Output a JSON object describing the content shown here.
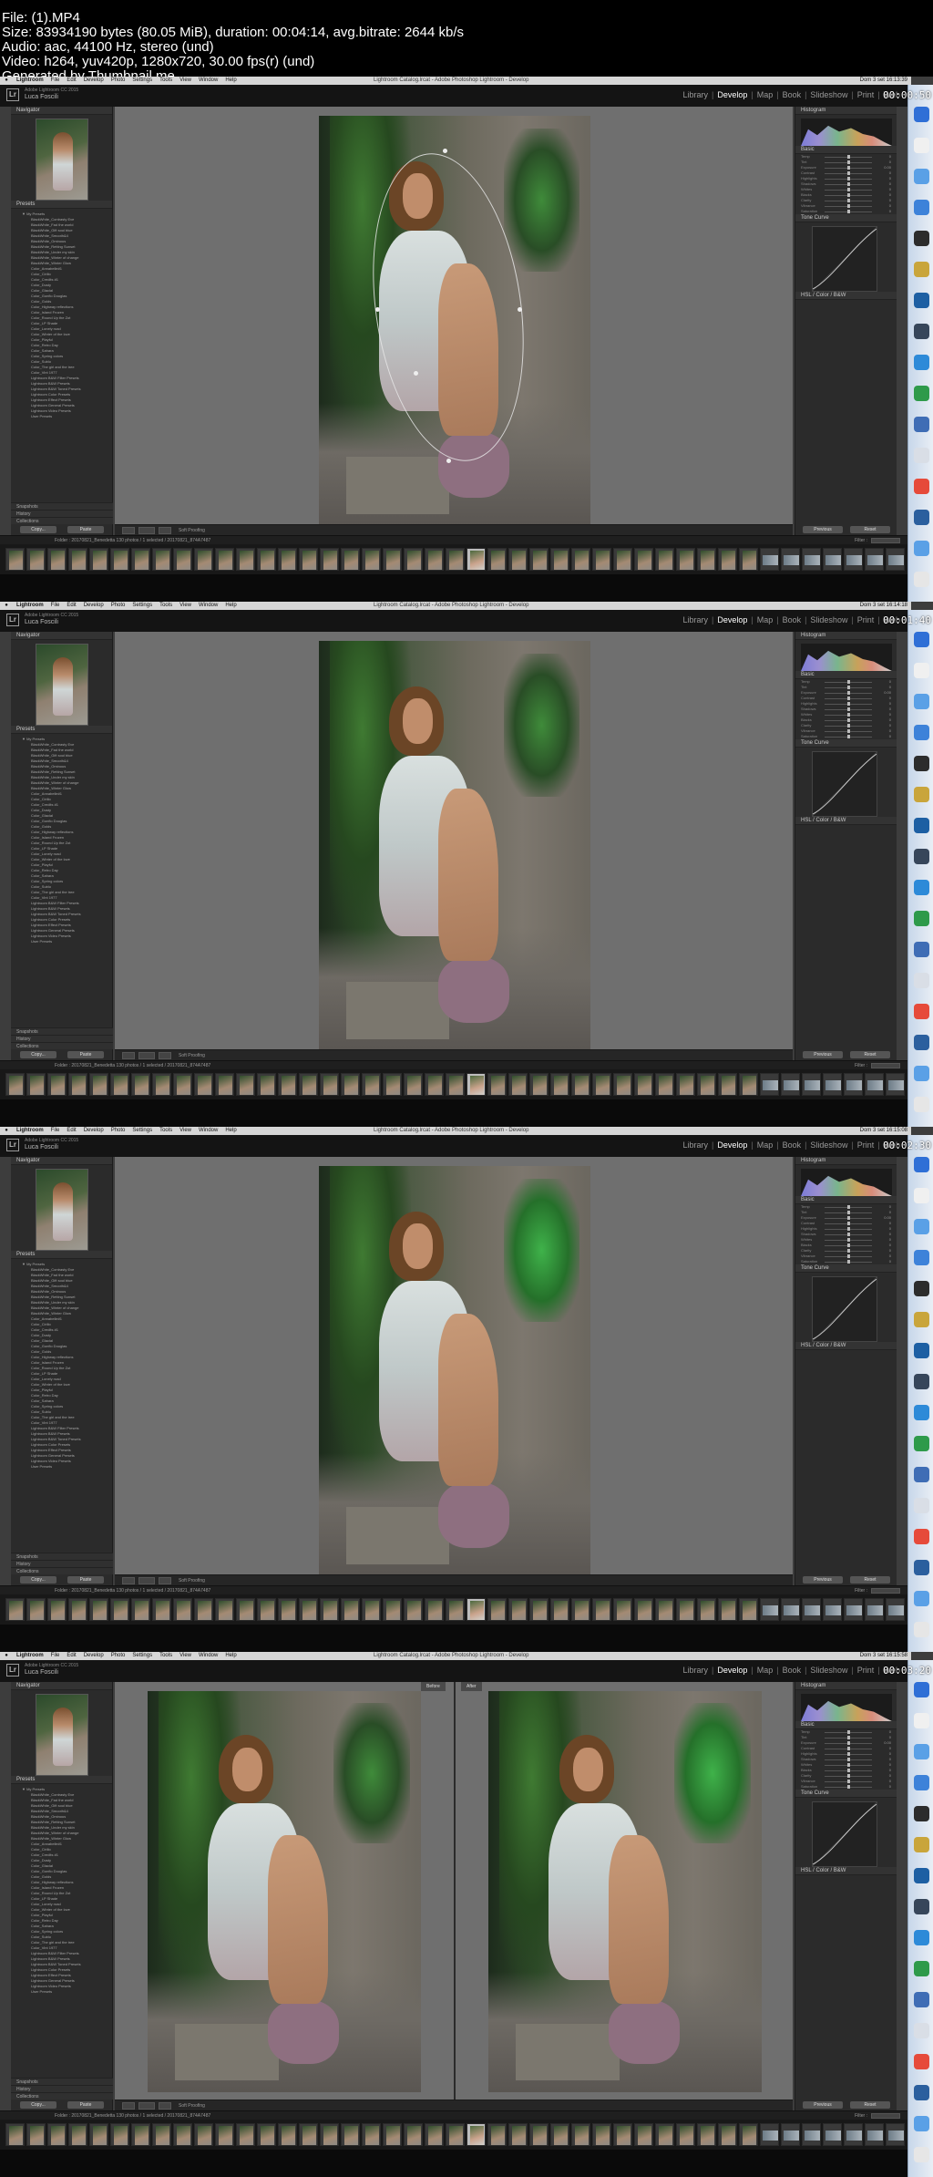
{
  "file_info": [
    "File:  (1).MP4",
    "Size: 83934190 bytes (80.05 MiB), duration: 00:04:14, avg.bitrate: 2644 kb/s",
    "Audio: aac, 44100 Hz, stereo (und)",
    "Video: h264, yuv420p, 1280x720, 30.00 fps(r) (und)",
    "Generated by Thumbnail me"
  ],
  "mac_menu": {
    "app": "Lightroom",
    "items": [
      "File",
      "Edit",
      "Develop",
      "Photo",
      "Settings",
      "Tools",
      "View",
      "Window",
      "Help"
    ]
  },
  "window_title": "Lightroom Catalog.lrcat - Adobe Photoshop Lightroom - Develop",
  "lr": {
    "logo": "Lr",
    "version": "Adobe Lightroom CC 2015",
    "user": "Luca Foscili"
  },
  "modules": [
    "Library",
    "Develop",
    "Map",
    "Book",
    "Slideshow",
    "Print",
    "Web"
  ],
  "active_module": "Develop",
  "left_panel": {
    "navigator": "Navigator",
    "presets": "Presets",
    "presets_items": [
      "▼ My Presets",
      "BlackWhite_Contrasty Eve",
      "BlackWhite_Fad the world",
      "BlackWhite_Gift soul blue",
      "BlackWhite_Smooth&4",
      "BlackWhite_Ominous",
      "BlackWhite_Retting Sunset",
      "BlackWhite_Under my skin",
      "BlackWhite_Winter of change",
      "BlackWhite_Winter Glow",
      "Color_Annabelle#1",
      "Color_Cirillo",
      "Color_Credits #1",
      "Color_Dusty",
      "Color_Glacial",
      "Color_Gonfio Douglas",
      "Color_Golds",
      "Color_Highway reflections",
      "Color_Island Frozen",
      "Color_Round Up the Zot",
      "Color_LP Shade",
      "Color_Lonely road",
      "Color_Winter of the love",
      "Color_Playful",
      "Color_Retro Day",
      "Color_Sahara",
      "Color_Spring colors",
      "Color_Sublo",
      "Color_The girl and the tree",
      "Color_Vint 1977",
      "Lightroom B&W Filter Presets",
      "Lightroom B&W Presets",
      "Lightroom B&W Toned Presets",
      "Lightroom Color Presets",
      "Lightroom Effect Presets",
      "Lightroom General Presets",
      "Lightroom Video Presets",
      "User Presets"
    ],
    "snapshots": "Snapshots",
    "history": "History",
    "collections": "Collections",
    "copy_button": "Copy...",
    "paste_button": "Paste"
  },
  "right_panel": {
    "histogram": "Histogram",
    "basic": "Basic",
    "tone_curve": "Tone Curve",
    "hsl": "HSL / Color / B&W",
    "previous_button": "Previous",
    "reset_button": "Reset",
    "sliders": [
      {
        "label": "Temp",
        "value": "0",
        "pos": 0.5
      },
      {
        "label": "Tint",
        "value": "0",
        "pos": 0.5
      },
      {
        "label": "Exposure",
        "value": "0.00",
        "pos": 0.5
      },
      {
        "label": "Contrast",
        "value": "0",
        "pos": 0.5
      },
      {
        "label": "Highlights",
        "value": "0",
        "pos": 0.5
      },
      {
        "label": "Shadows",
        "value": "0",
        "pos": 0.5
      },
      {
        "label": "Whites",
        "value": "0",
        "pos": 0.5
      },
      {
        "label": "Blacks",
        "value": "0",
        "pos": 0.5
      },
      {
        "label": "Clarity",
        "value": "0",
        "pos": 0.5
      },
      {
        "label": "Vibrance",
        "value": "0",
        "pos": 0.5
      },
      {
        "label": "Saturation",
        "value": "0",
        "pos": 0.5
      }
    ]
  },
  "toolbar": {
    "soft_proofing": "Soft Proofing",
    "before_label": "Before",
    "after_label": "After"
  },
  "filmstrip": {
    "source": "Folder : 20170821_Benedetta    130 photos / 1 selected / 20170821_874A7487",
    "filter_label": "Filter :"
  },
  "frames": [
    {
      "clock": "Dom 3 set  16:13:39",
      "timecode": "00:00:50",
      "view": "mask",
      "selected_thumb": 22
    },
    {
      "clock": "Dom 3 set  16:14:18",
      "timecode": "00:01:40",
      "view": "single",
      "selected_thumb": 22
    },
    {
      "clock": "Dom 3 set  16:15:08",
      "timecode": "00:02:30",
      "view": "single-green",
      "selected_thumb": 22
    },
    {
      "clock": "Dom 3 set  16:15:58",
      "timecode": "00:03:20",
      "view": "before-after",
      "selected_thumb": 22
    }
  ]
}
